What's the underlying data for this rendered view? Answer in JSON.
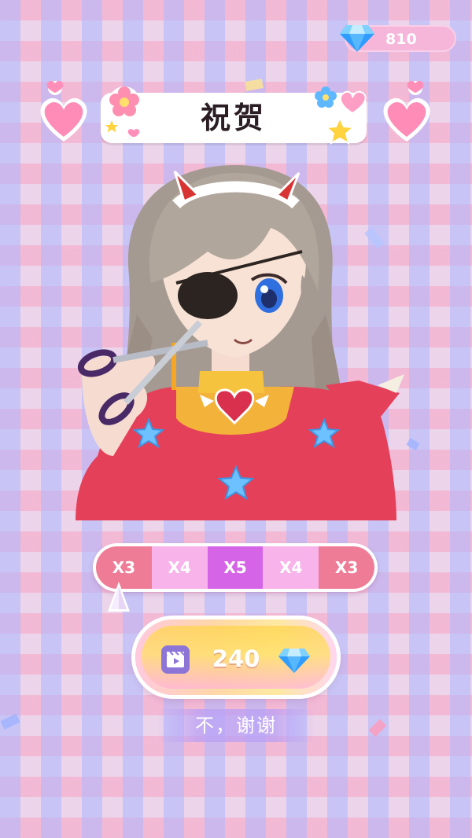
{
  "currency": {
    "amount": "810",
    "icon": "diamond-gem-icon"
  },
  "title": "祝贺",
  "portrait": {
    "subject": "anime-girl-with-scissors"
  },
  "multiplier": {
    "segments": [
      {
        "label": "X3",
        "color": "#ef7c96"
      },
      {
        "label": "X4",
        "color": "#f7b3ea"
      },
      {
        "label": "X5",
        "color": "#d565e6"
      },
      {
        "label": "X4",
        "color": "#f7b3ea"
      },
      {
        "label": "X3",
        "color": "#ef7c96"
      }
    ]
  },
  "reward": {
    "amount": "240",
    "icon": "diamond-gem-icon",
    "ad_icon": "video-clapper-icon"
  },
  "decline": {
    "label": "不，谢谢"
  },
  "colors": {
    "gem": "#3aa8ff",
    "pill": "#f6b6da",
    "accent_purple": "#d565e6"
  }
}
